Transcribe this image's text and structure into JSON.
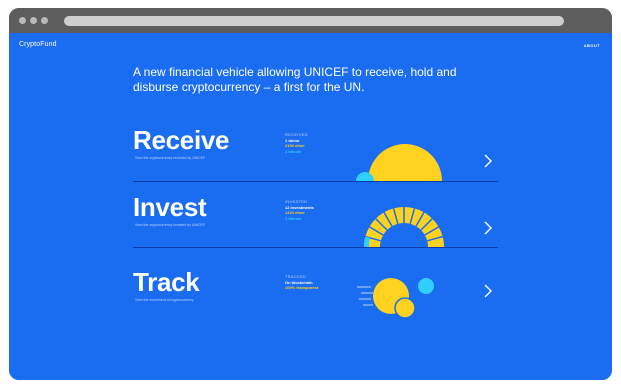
{
  "site": {
    "brand": "CryptoFund",
    "about_label": "ABOUT"
  },
  "headline": "A new financial vehicle allowing UNICEF to receive, hold and disburse cryptocurrency – a first for the UN.",
  "sections": [
    {
      "title": "Receive",
      "subtitle": "View the cryptocurrency received by UNICEF",
      "stats": {
        "heading": "RECEIVED",
        "line1": "1 donor",
        "line2": "2100 ether",
        "line3": "1 bitcoin"
      }
    },
    {
      "title": "Invest",
      "subtitle": "View the cryptocurrency invested by UNICEF",
      "stats": {
        "heading": "INVESTED",
        "line1": "12 investments",
        "line2": "1223 ether",
        "line3": "1 bitcoin"
      }
    },
    {
      "title": "Track",
      "subtitle": "View the movement of cryptocurrency",
      "stats": {
        "heading": "TRACKED",
        "line1": "On blockchain",
        "line2": "100% transparent",
        "line3": ""
      }
    }
  ],
  "colors": {
    "background": "#1a6cf0",
    "accent_yellow": "#ffd21f",
    "accent_cyan": "#2fd0ff"
  },
  "icons": {
    "chevron": "chevron-right-icon"
  }
}
